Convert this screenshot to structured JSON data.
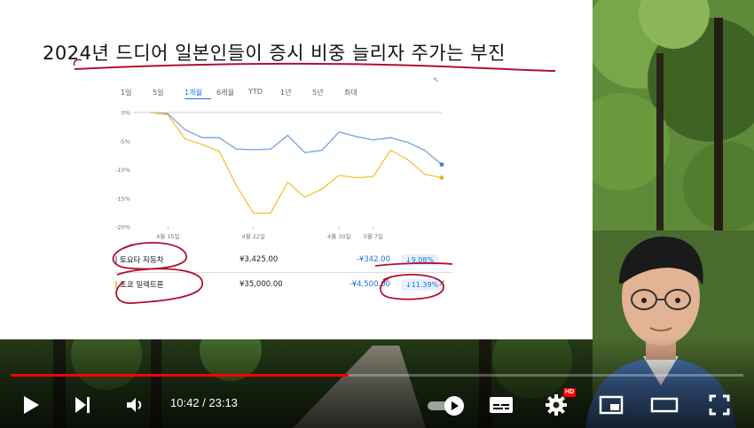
{
  "slide": {
    "title": "2024년 드디어 일본인들이 증시 비중 늘리자 주가는 부진",
    "range_tabs": [
      "1일",
      "5일",
      "1개월",
      "6개월",
      "YTD",
      "1년",
      "5년",
      "최대"
    ],
    "active_tab_index": 2
  },
  "chart_data": {
    "type": "line",
    "title": "",
    "xlabel": "",
    "ylabel": "",
    "ylim": [
      -20,
      0
    ],
    "y_ticks": [
      "0%",
      "-5%",
      "-10%",
      "-15%",
      "-20%"
    ],
    "x_ticks": [
      "4월 15일",
      "4월 22일",
      "4월 30일",
      "5월 7일"
    ],
    "x": [
      "4/12",
      "4/15",
      "4/16",
      "4/17",
      "4/18",
      "4/19",
      "4/22",
      "4/23",
      "4/24",
      "4/25",
      "4/26",
      "5/1",
      "5/2",
      "5/7",
      "5/8",
      "5/9",
      "5/10",
      "5/13"
    ],
    "series": [
      {
        "name": "토요타 자동차",
        "color": "#7ea6e0",
        "values": [
          0,
          -0.2,
          -3.0,
          -4.4,
          -4.4,
          -6.4,
          -6.5,
          -6.4,
          -4.0,
          -7.0,
          -6.6,
          -3.4,
          -4.2,
          -4.8,
          -4.4,
          -5.2,
          -6.6,
          -9.1
        ]
      },
      {
        "name": "도쿄 일렉트론",
        "color": "#f2c744",
        "values": [
          0,
          -0.4,
          -4.6,
          -5.6,
          -6.8,
          -12.8,
          -17.6,
          -17.6,
          -12.2,
          -14.8,
          -13.4,
          -11.0,
          -11.4,
          -11.2,
          -6.6,
          -8.2,
          -10.8,
          -11.4
        ]
      }
    ]
  },
  "legend": [
    {
      "name": "토요타 자동차",
      "price": "¥3,425.00",
      "change": "-¥342.00",
      "percent": "↓9.08%",
      "color": "#7ea6e0"
    },
    {
      "name": "도쿄 일렉트론",
      "price": "¥35,000.00",
      "change": "-¥4,500.00",
      "percent": "↓11.39%",
      "color": "#f2c744"
    }
  ],
  "player": {
    "current_time": "10:42",
    "duration": "23:13",
    "time_display": "10:42 / 23:13",
    "progress": 0.461,
    "hd_label": "HD",
    "accent": "#ff0000"
  }
}
